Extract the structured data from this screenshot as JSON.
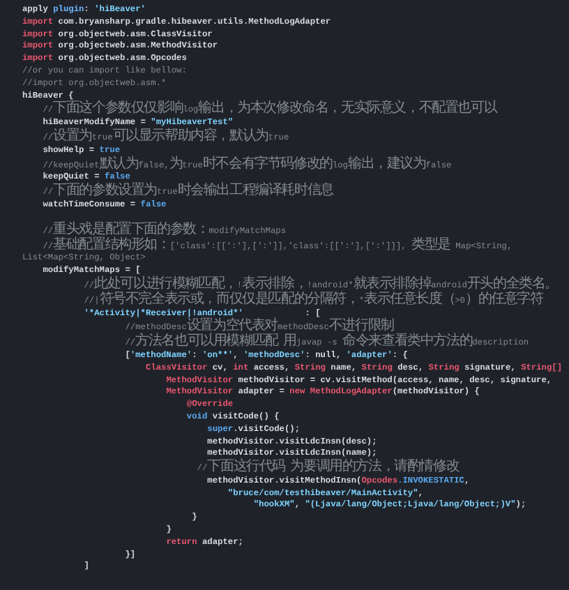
{
  "editor": {
    "blocks": [
      {
        "lines": [
          {
            "segments": [
              {
                "text": "apply ",
                "kind": "plain"
              },
              {
                "text": "plugin",
                "kind": "accent"
              },
              {
                "text": ": ",
                "kind": "plain"
              },
              {
                "text": "'hiBeaver'",
                "kind": "string"
              }
            ]
          },
          {
            "segments": [
              {
                "text": "import ",
                "kind": "keyword"
              },
              {
                "text": "com.bryansharp.gradle.hibeaver.utils.MethodLogAdapter",
                "kind": "plain"
              }
            ]
          },
          {
            "segments": [
              {
                "text": "import ",
                "kind": "keyword"
              },
              {
                "text": "org.objectweb.asm.ClassVisitor",
                "kind": "plain"
              }
            ]
          },
          {
            "segments": [
              {
                "text": "import ",
                "kind": "keyword"
              },
              {
                "text": "org.objectweb.asm.MethodVisitor",
                "kind": "plain"
              }
            ]
          },
          {
            "segments": [
              {
                "text": "import ",
                "kind": "keyword"
              },
              {
                "text": "org.objectweb.asm.Opcodes",
                "kind": "plain"
              }
            ]
          },
          {
            "segments": [
              {
                "text": "//or you can import like bellow:",
                "kind": "comment"
              }
            ]
          },
          {
            "segments": [
              {
                "text": "//import org.objectweb.asm.*",
                "kind": "comment"
              }
            ]
          },
          {
            "segments": [
              {
                "text": "hiBeaver {",
                "kind": "plain"
              }
            ]
          },
          {
            "segments": [
              {
                "text": "    //下面这个参数仅仅影响log输出，为本次修改命名，无实际意义，不配置也可以",
                "kind": "comment"
              }
            ]
          },
          {
            "segments": [
              {
                "text": "    hiBeaverModifyName = ",
                "kind": "plain"
              },
              {
                "text": "\"myHibeaverTest\"",
                "kind": "string"
              }
            ]
          },
          {
            "segments": [
              {
                "text": "    //设置为true可以显示帮助内容，默认为true",
                "kind": "comment"
              }
            ]
          },
          {
            "segments": [
              {
                "text": "    showHelp = ",
                "kind": "plain"
              },
              {
                "text": "true",
                "kind": "value"
              }
            ]
          },
          {
            "segments": [
              {
                "text": "    //keepQuiet默认为false,为true时不会有字节码修改的log输出，建议为false",
                "kind": "comment"
              }
            ]
          },
          {
            "segments": [
              {
                "text": "    keepQuiet = ",
                "kind": "plain"
              },
              {
                "text": "false",
                "kind": "value"
              }
            ]
          },
          {
            "segments": [
              {
                "text": "    //下面的参数设置为true时会输出工程编译耗时信息",
                "kind": "comment"
              }
            ]
          },
          {
            "segments": [
              {
                "text": "    watchTimeConsume = ",
                "kind": "plain"
              },
              {
                "text": "false",
                "kind": "value"
              }
            ]
          }
        ]
      },
      {
        "lines": [
          {
            "segments": [
              {
                "text": "    //重头戏是配置下面的参数：modifyMatchMaps",
                "kind": "comment"
              }
            ]
          },
          {
            "segments": [
              {
                "text": "    //基础配置结构形如：['class':[[':'],[':']],'class':[[':'],[':']]], 类型是 Map<String, List<Map<String, Object>",
                "kind": "comment"
              }
            ]
          },
          {
            "segments": [
              {
                "text": "    modifyMatchMaps = [",
                "kind": "plain"
              }
            ]
          },
          {
            "segments": [
              {
                "text": "            //此处可以进行模糊匹配，!表示排除，!android*就表示排除掉android开头的全类名。",
                "kind": "comment"
              }
            ]
          },
          {
            "segments": [
              {
                "text": "            //|符号不完全表示或，而仅仅是匹配的分隔符，*表示任意长度（>0）的任意字符",
                "kind": "comment"
              }
            ]
          },
          {
            "segments": [
              {
                "text": "            '*Activity|*Receiver|!android*'",
                "kind": "string"
              },
              {
                "text": "            : [",
                "kind": "plain"
              }
            ]
          },
          {
            "segments": [
              {
                "text": "                    //methodDesc设置为空代表对methodDesc不进行限制",
                "kind": "comment"
              }
            ]
          },
          {
            "segments": [
              {
                "text": "                    //方法名也可以用模糊匹配 用javap -s 命令来查看类中方法的description",
                "kind": "comment"
              }
            ]
          },
          {
            "segments": [
              {
                "text": "                    [",
                "kind": "plain"
              },
              {
                "text": "'methodName'",
                "kind": "string"
              },
              {
                "text": ": ",
                "kind": "plain"
              },
              {
                "text": "'on**'",
                "kind": "string"
              },
              {
                "text": ", ",
                "kind": "plain"
              },
              {
                "text": "'methodDesc'",
                "kind": "string"
              },
              {
                "text": ": null, ",
                "kind": "plain"
              },
              {
                "text": "'adapter'",
                "kind": "string"
              },
              {
                "text": ": {",
                "kind": "plain"
              }
            ]
          },
          {
            "segments": [
              {
                "text": "                        ClassVisitor",
                "kind": "keyword"
              },
              {
                "text": " cv, ",
                "kind": "plain"
              },
              {
                "text": "int",
                "kind": "keyword"
              },
              {
                "text": " access, ",
                "kind": "plain"
              },
              {
                "text": "String",
                "kind": "keyword"
              },
              {
                "text": " name, ",
                "kind": "plain"
              },
              {
                "text": "String",
                "kind": "keyword"
              },
              {
                "text": " desc, ",
                "kind": "plain"
              },
              {
                "text": "String",
                "kind": "keyword"
              },
              {
                "text": " signature, ",
                "kind": "plain"
              },
              {
                "text": "String[]",
                "kind": "keyword"
              }
            ]
          },
          {
            "segments": [
              {
                "text": "                            MethodVisitor",
                "kind": "keyword"
              },
              {
                "text": " methodVisitor = cv.visitMethod(access, name, desc, signature,",
                "kind": "plain"
              }
            ]
          },
          {
            "segments": [
              {
                "text": "                            MethodVisitor",
                "kind": "keyword"
              },
              {
                "text": " adapter = ",
                "kind": "plain"
              },
              {
                "text": "new MethodLogAdapter",
                "kind": "keyword"
              },
              {
                "text": "(methodVisitor) {",
                "kind": "plain"
              }
            ]
          },
          {
            "segments": [
              {
                "text": "                                @Override",
                "kind": "keyword"
              }
            ]
          },
          {
            "segments": [
              {
                "text": "                                void",
                "kind": "value"
              },
              {
                "text": " visitCode() {",
                "kind": "plain"
              }
            ]
          },
          {
            "segments": [
              {
                "text": "                                    super",
                "kind": "value"
              },
              {
                "text": ".visitCode();",
                "kind": "plain"
              }
            ]
          },
          {
            "segments": [
              {
                "text": "                                    methodVisitor.visitLdcInsn(desc);",
                "kind": "plain"
              }
            ]
          },
          {
            "segments": [
              {
                "text": "                                    methodVisitor.visitLdcInsn(name);",
                "kind": "plain"
              }
            ]
          },
          {
            "segments": [
              {
                "text": "                                  //下面这行代码 为要调用的方法，请酌情修改",
                "kind": "comment"
              }
            ]
          },
          {
            "segments": [
              {
                "text": "                                    methodVisitor.visitMethodInsn(",
                "kind": "plain"
              },
              {
                "text": "Opcodes",
                "kind": "keyword"
              },
              {
                "text": ".INVOKESTATIC",
                "kind": "value"
              },
              {
                "text": ",",
                "kind": "plain"
              }
            ]
          },
          {
            "segments": [
              {
                "text": "                                        \"bruce/com/testhibeaver/MainActivity\"",
                "kind": "string"
              },
              {
                "text": ",",
                "kind": "plain"
              }
            ]
          },
          {
            "segments": [
              {
                "text": "                                             \"hookXM\"",
                "kind": "string"
              },
              {
                "text": ", ",
                "kind": "plain"
              },
              {
                "text": "\"(Ljava/lang/Object;Ljava/lang/Object;)V\"",
                "kind": "string"
              },
              {
                "text": ");",
                "kind": "plain"
              }
            ]
          },
          {
            "segments": [
              {
                "text": "                                 }",
                "kind": "plain"
              }
            ]
          },
          {
            "segments": [
              {
                "text": "                            }",
                "kind": "plain"
              }
            ]
          },
          {
            "segments": [
              {
                "text": "                            return",
                "kind": "keyword"
              },
              {
                "text": " adapter;",
                "kind": "plain"
              }
            ]
          },
          {
            "segments": [
              {
                "text": "                    }]",
                "kind": "plain"
              }
            ]
          },
          {
            "segments": [
              {
                "text": "            ]",
                "kind": "plain"
              }
            ]
          }
        ]
      }
    ]
  }
}
